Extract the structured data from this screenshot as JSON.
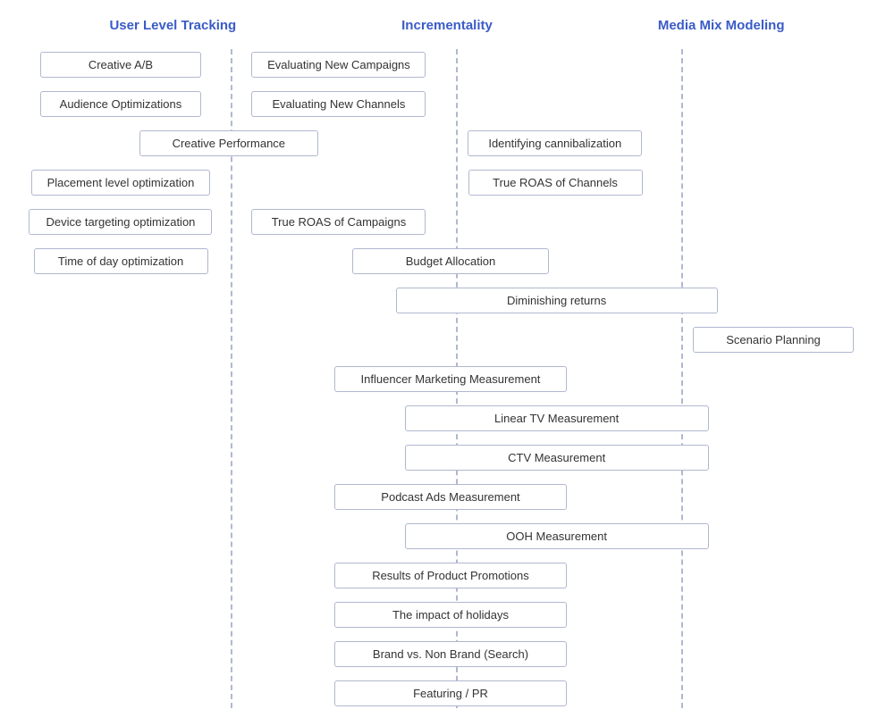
{
  "headers": {
    "col1": "User Level Tracking",
    "col2": "Incrementality",
    "col3": "Media Mix Modeling"
  },
  "rows": [
    {
      "r1_c1": "Creative A/B",
      "r1_c2": "Evaluating New Campaigns"
    },
    {
      "r2_c1": "Audience Optimizations",
      "r2_c2": "Evaluating New Channels"
    },
    {
      "r3_c12": "Creative Performance",
      "r3_c3": "Identifying cannibalization"
    },
    {
      "r4_c1": "Placement level optimization",
      "r4_c3": "True ROAS of Channels"
    },
    {
      "r5_c1": "Device targeting optimization",
      "r5_c2": "True ROAS of Campaigns"
    },
    {
      "r6_c1": "Time of day optimization",
      "r6_c23": "Budget Allocation"
    },
    {
      "r7_c234": "Diminishing returns"
    },
    {
      "r8_c4": "Scenario Planning"
    },
    {
      "r9_c23": "Influencer Marketing Measurement"
    },
    {
      "r10_c234": "Linear TV Measurement"
    },
    {
      "r11_c234": "CTV Measurement"
    },
    {
      "r12_c23": "Podcast Ads Measurement"
    },
    {
      "r13_c234": "OOH Measurement"
    },
    {
      "r14_c23": "Results of Product Promotions"
    },
    {
      "r15_c23": "The impact of holidays"
    },
    {
      "r16_c23": "Brand vs. Non Brand (Search)"
    },
    {
      "r17_c23": "Featuring / PR"
    }
  ]
}
